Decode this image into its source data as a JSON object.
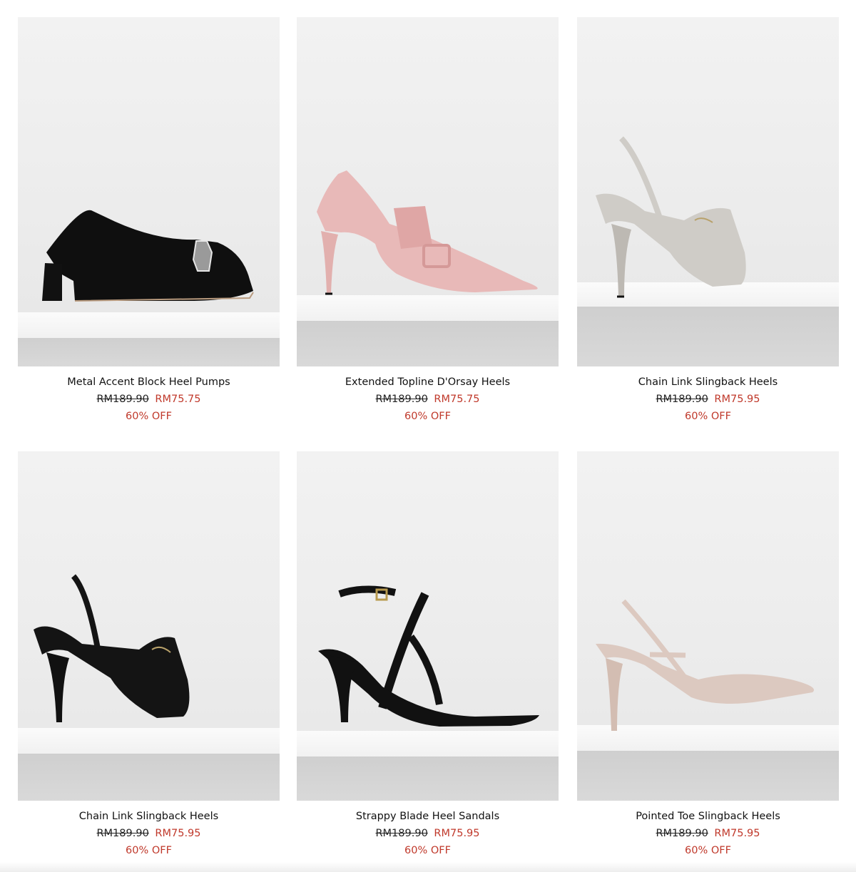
{
  "products": [
    {
      "name": "Metal Accent Block Heel Pumps",
      "original_price": "RM189.90",
      "sale_price": "RM75.75",
      "discount": "60% OFF",
      "image_alt": "Black block heel pump with metal accent",
      "shoe_color": "#111111"
    },
    {
      "name": "Extended Topline D'Orsay Heels",
      "original_price": "RM189.90",
      "sale_price": "RM75.75",
      "discount": "60% OFF",
      "image_alt": "Pink d'orsay heel with buckle",
      "shoe_color": "#e8b9b8"
    },
    {
      "name": "Chain Link Slingback Heels",
      "original_price": "RM189.90",
      "sale_price": "RM75.95",
      "discount": "60% OFF",
      "image_alt": "Grey chain link slingback heel",
      "shoe_color": "#cfccc7"
    },
    {
      "name": "Chain Link Slingback Heels",
      "original_price": "RM189.90",
      "sale_price": "RM75.95",
      "discount": "60% OFF",
      "image_alt": "Black chain link slingback heel",
      "shoe_color": "#141414"
    },
    {
      "name": "Strappy Blade Heel Sandals",
      "original_price": "RM189.90",
      "sale_price": "RM75.95",
      "discount": "60% OFF",
      "image_alt": "Black strappy blade heel sandal",
      "shoe_color": "#111111"
    },
    {
      "name": "Pointed Toe Slingback Heels",
      "original_price": "RM189.90",
      "sale_price": "RM75.95",
      "discount": "60% OFF",
      "image_alt": "Nude pointed toe slingback heel",
      "shoe_color": "#dcc9c0"
    }
  ],
  "colors": {
    "sale": "#c0392b",
    "text": "#111111"
  }
}
